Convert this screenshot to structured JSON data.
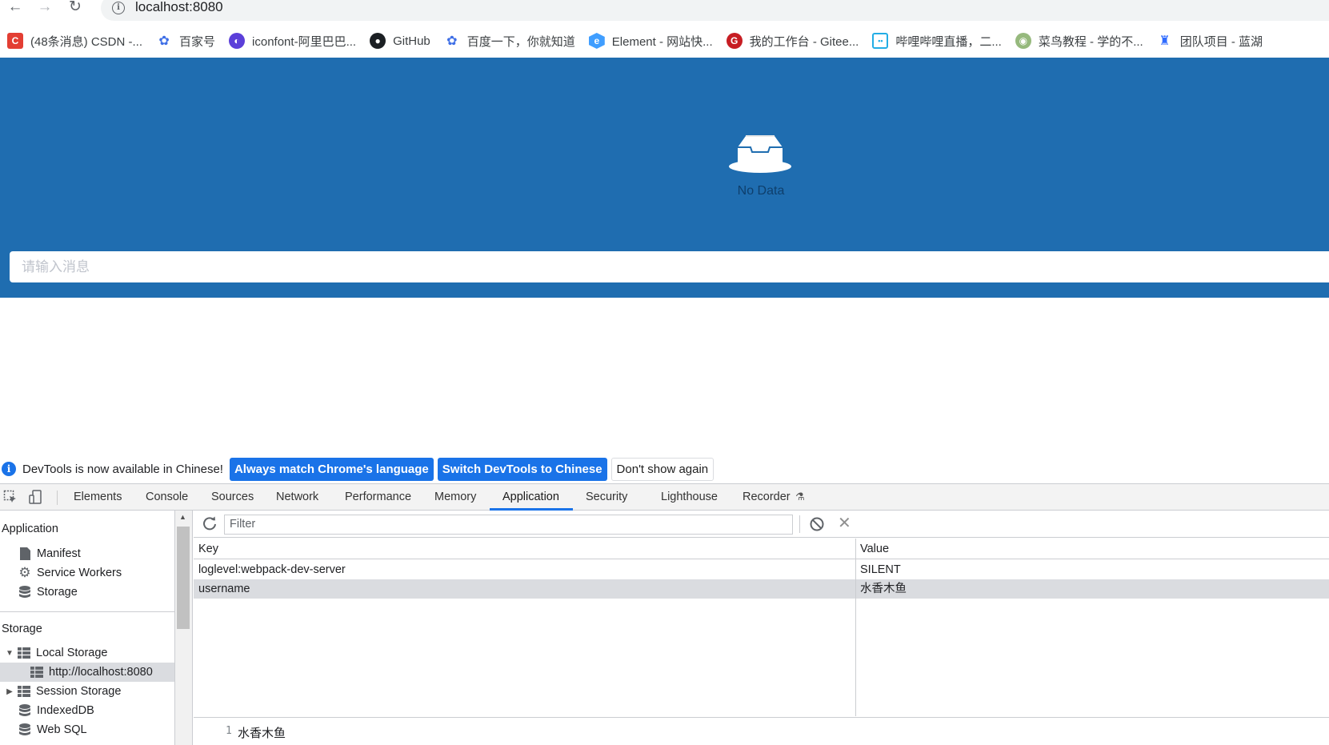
{
  "browser": {
    "url": "localhost:8080",
    "bookmarks": [
      {
        "label": "(48条消息) CSDN -...",
        "icon": "csdn-icon",
        "color": "#e33e33"
      },
      {
        "label": "百家号",
        "icon": "paw-icon",
        "color": "#3f6fe6"
      },
      {
        "label": "iconfont-阿里巴巴...",
        "icon": "iconfont-icon",
        "color": "#5b3fd9"
      },
      {
        "label": "GitHub",
        "icon": "github-icon",
        "color": "#1b1f23"
      },
      {
        "label": "百度一下，你就知道",
        "icon": "paw-icon",
        "color": "#3f6fe6"
      },
      {
        "label": "Element - 网站快...",
        "icon": "element-icon",
        "color": "#409eff"
      },
      {
        "label": "我的工作台 - Gitee...",
        "icon": "gitee-icon",
        "color": "#c71d23"
      },
      {
        "label": "哔哩哔哩直播，二...",
        "icon": "bilibili-icon",
        "color": "#23ade5"
      },
      {
        "label": "菜鸟教程 - 学的不...",
        "icon": "runoob-icon",
        "color": "#96b97d"
      },
      {
        "label": "团队项目 - 蓝湖",
        "icon": "lanhu-icon",
        "color": "#2f6bff"
      }
    ]
  },
  "page": {
    "empty_text": "No Data",
    "input_placeholder": "请输入消息",
    "bg_color": "#1f6db0"
  },
  "devtools": {
    "infobar": {
      "message": "DevTools is now available in Chinese!",
      "btn_match": "Always match Chrome's language",
      "btn_switch": "Switch DevTools to Chinese",
      "btn_dismiss": "Don't show again"
    },
    "tabs": [
      "Elements",
      "Console",
      "Sources",
      "Network",
      "Performance",
      "Memory",
      "Application",
      "Security",
      "Lighthouse",
      "Recorder"
    ],
    "active_tab": "Application",
    "sidebar": {
      "app_header": "Application",
      "app_items": [
        "Manifest",
        "Service Workers",
        "Storage"
      ],
      "storage_header": "Storage",
      "local_storage": "Local Storage",
      "local_origin": "http://localhost:8080",
      "session_storage": "Session Storage",
      "indexeddb": "IndexedDB",
      "websql": "Web SQL"
    },
    "filter_placeholder": "Filter",
    "table": {
      "col_key": "Key",
      "col_value": "Value",
      "rows": [
        {
          "key": "loglevel:webpack-dev-server",
          "value": "SILENT"
        },
        {
          "key": "username",
          "value": "水香木鱼"
        }
      ]
    },
    "preview": {
      "line": "1",
      "value": "水香木鱼"
    }
  }
}
